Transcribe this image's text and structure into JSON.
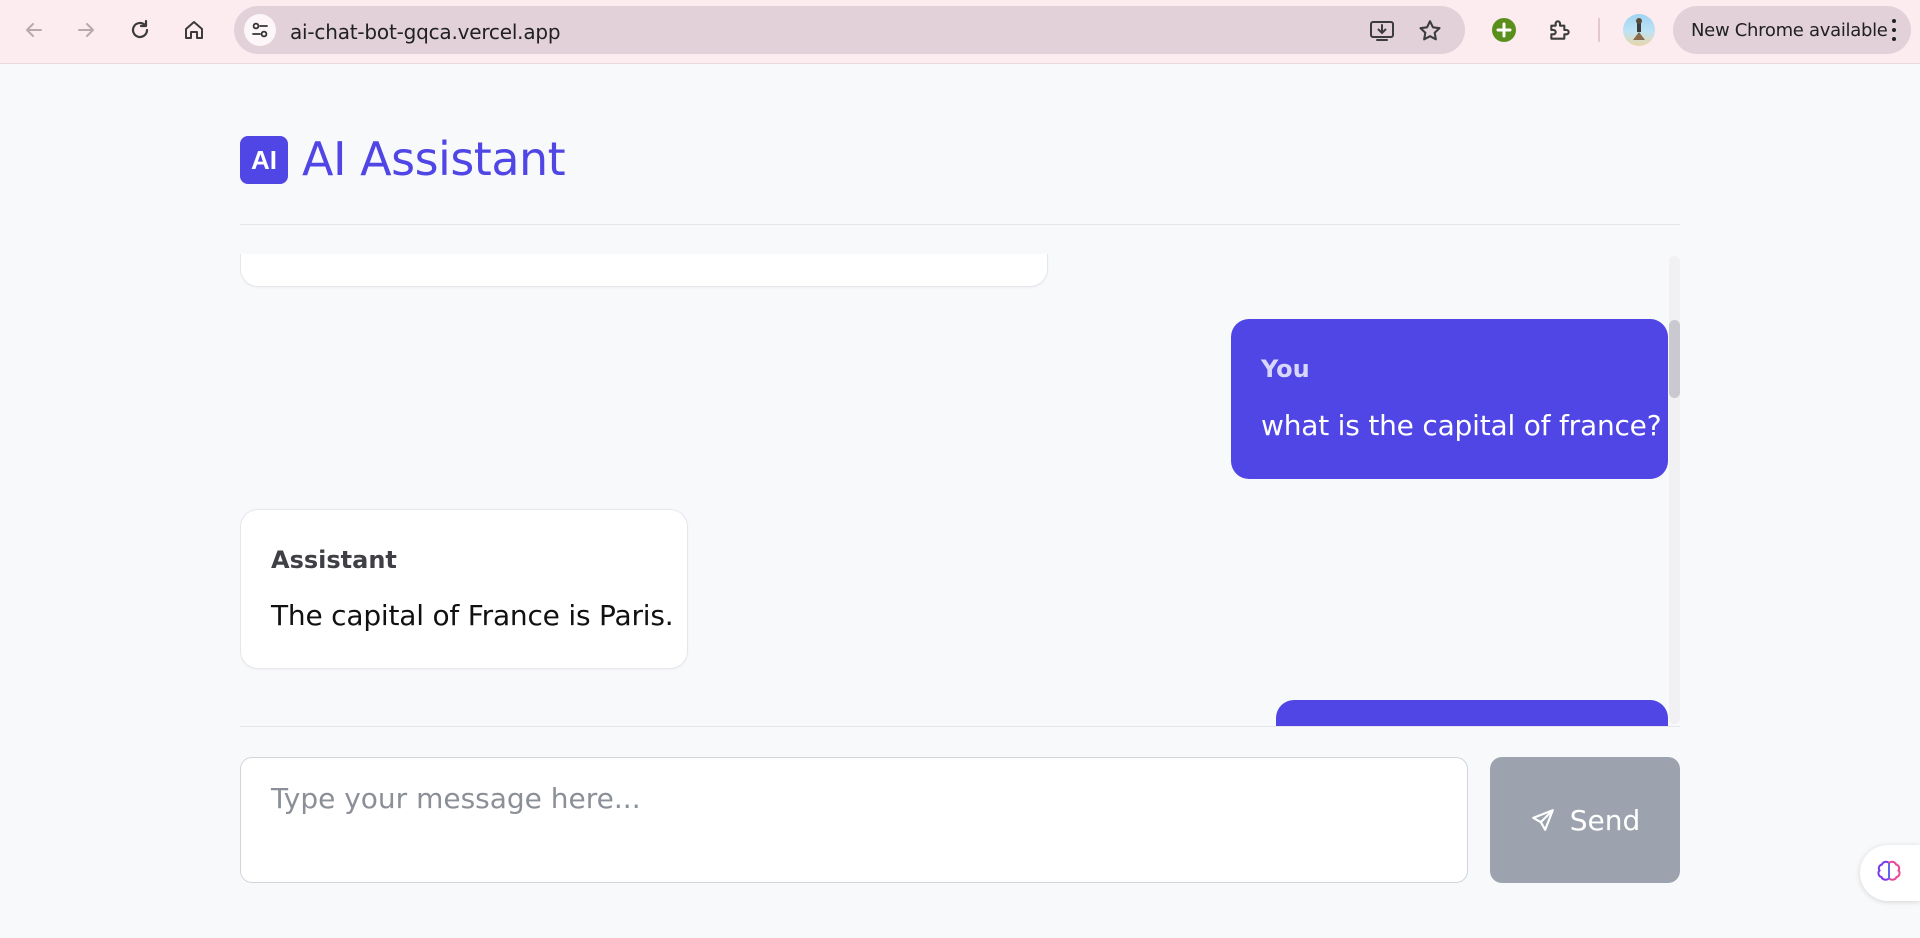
{
  "browser": {
    "url": "ai-chat-bot-gqca.vercel.app",
    "update_label": "New Chrome available"
  },
  "app": {
    "logo_text": "AI",
    "title": "AI Assistant",
    "accent_color": "#4f46e5"
  },
  "messages": [
    {
      "role": "You",
      "text": "what is the capital of france?"
    },
    {
      "role": "Assistant",
      "text": "The capital of France is Paris."
    }
  ],
  "composer": {
    "placeholder": "Type your message here...",
    "send_label": "Send"
  }
}
